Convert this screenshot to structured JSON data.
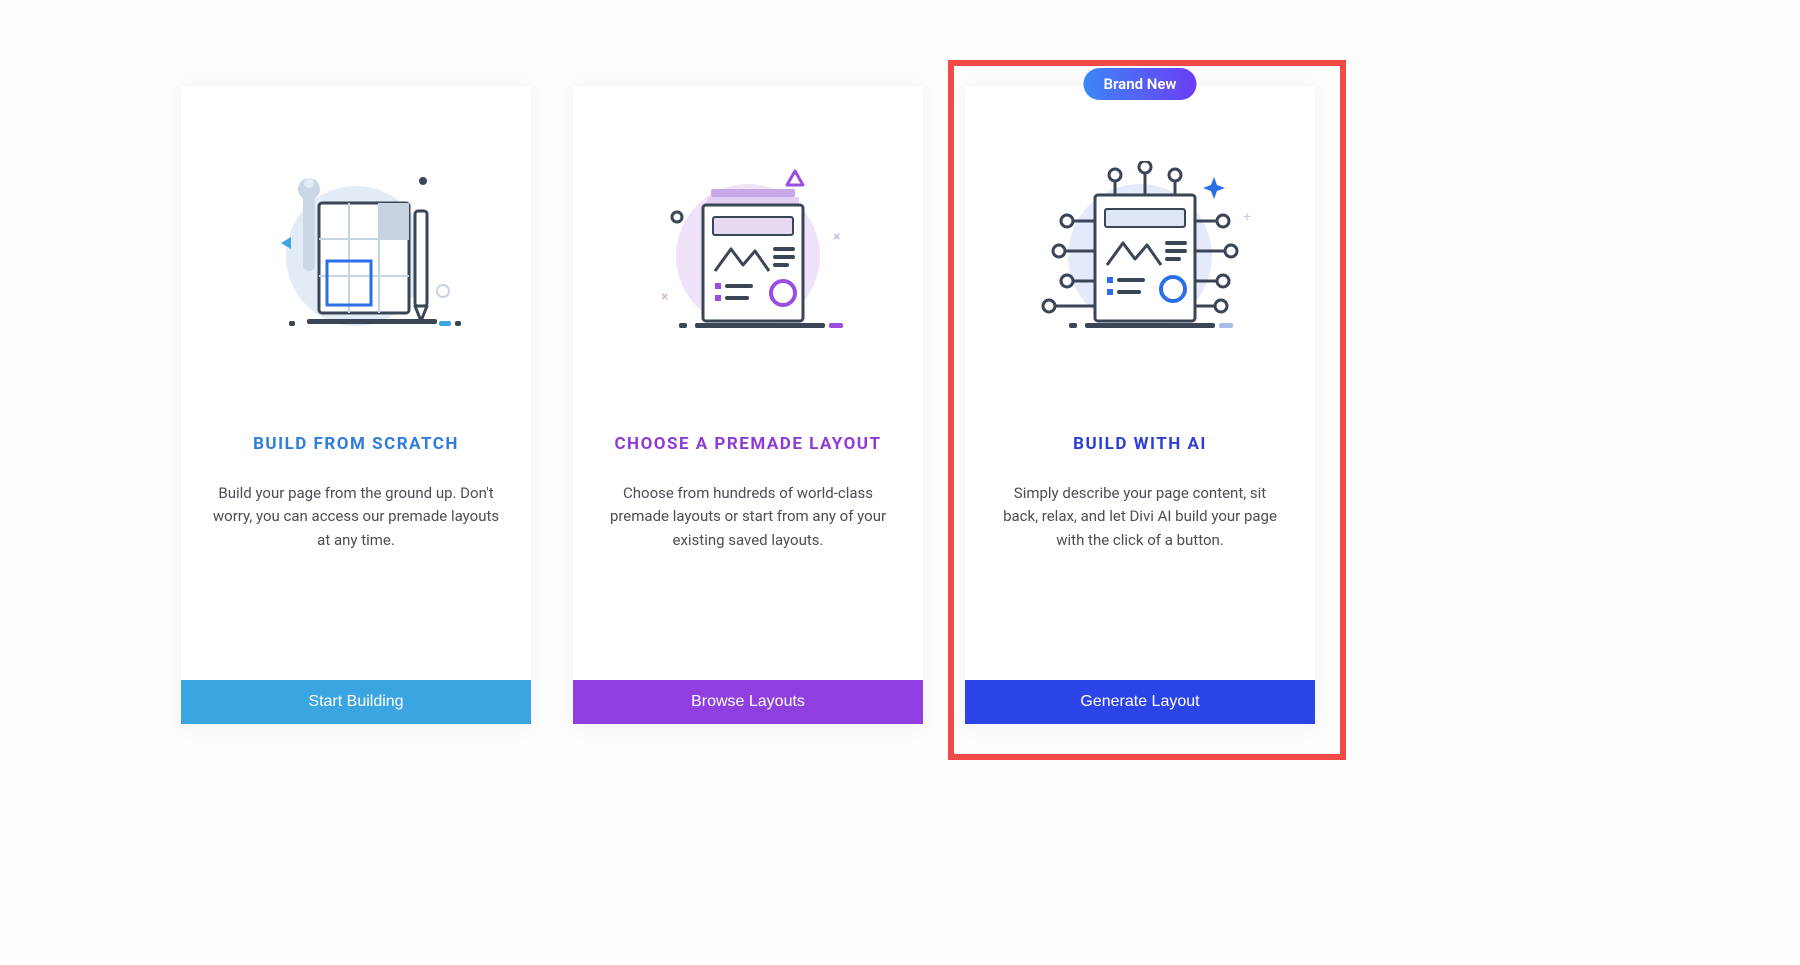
{
  "cards": [
    {
      "title": "BUILD FROM SCRATCH",
      "desc": "Build your page from the ground up. Don't worry, you can access our premade layouts at any time.",
      "button": "Start Building"
    },
    {
      "title": "CHOOSE A PREMADE LAYOUT",
      "desc": "Choose from hundreds of world-class premade layouts or start from any of your existing saved layouts.",
      "button": "Browse Layouts"
    },
    {
      "badge": "Brand New",
      "title": "BUILD WITH AI",
      "desc": "Simply describe your page content, sit back, relax, and let Divi AI build your page with the click of a button.",
      "button": "Generate Layout"
    }
  ]
}
